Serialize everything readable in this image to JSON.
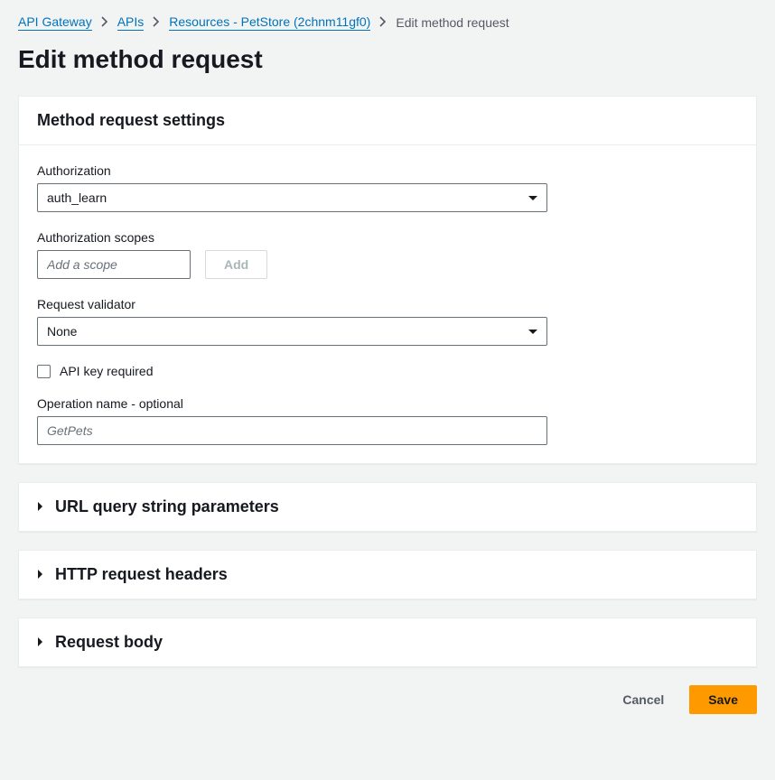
{
  "breadcrumb": {
    "items": [
      {
        "label": "API Gateway"
      },
      {
        "label": "APIs"
      },
      {
        "label": "Resources - PetStore (2chnm11gf0)"
      }
    ],
    "current": "Edit method request"
  },
  "page": {
    "title": "Edit method request"
  },
  "settings_panel": {
    "title": "Method request settings",
    "authorization": {
      "label": "Authorization",
      "value": "auth_learn"
    },
    "scopes": {
      "label": "Authorization scopes",
      "placeholder": "Add a scope",
      "add_button": "Add"
    },
    "validator": {
      "label": "Request validator",
      "value": "None"
    },
    "api_key": {
      "label": "API key required",
      "checked": false
    },
    "operation": {
      "label": "Operation name - optional",
      "placeholder": "GetPets",
      "value": ""
    }
  },
  "collapsibles": {
    "query": "URL query string parameters",
    "headers": "HTTP request headers",
    "body": "Request body"
  },
  "actions": {
    "cancel": "Cancel",
    "save": "Save"
  }
}
